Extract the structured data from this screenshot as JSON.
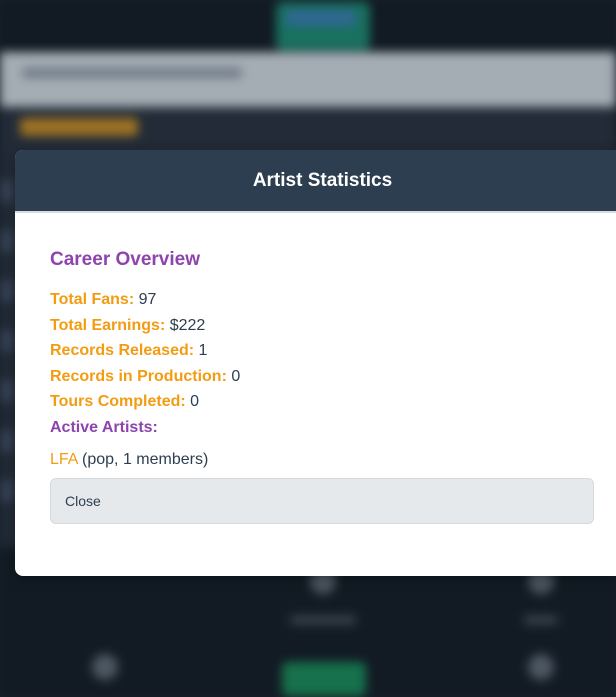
{
  "modal": {
    "title": "Artist Statistics",
    "section_title": "Career Overview",
    "stats": [
      {
        "label": "Total Fans:",
        "value": "97"
      },
      {
        "label": "Total Earnings:",
        "value": "$222"
      },
      {
        "label": "Records Released:",
        "value": "1"
      },
      {
        "label": "Records in Production:",
        "value": "0"
      },
      {
        "label": "Tours Completed:",
        "value": "0"
      }
    ],
    "active_artists_label": "Active Artists:",
    "artists": [
      {
        "name": "LFA",
        "details": "(pop, 1 members)"
      }
    ],
    "close_label": "Close"
  },
  "colors": {
    "header_bg": "#2c3e50",
    "label_orange": "#f39c12",
    "heading_purple": "#8e44ad",
    "text": "#2c3e50"
  }
}
